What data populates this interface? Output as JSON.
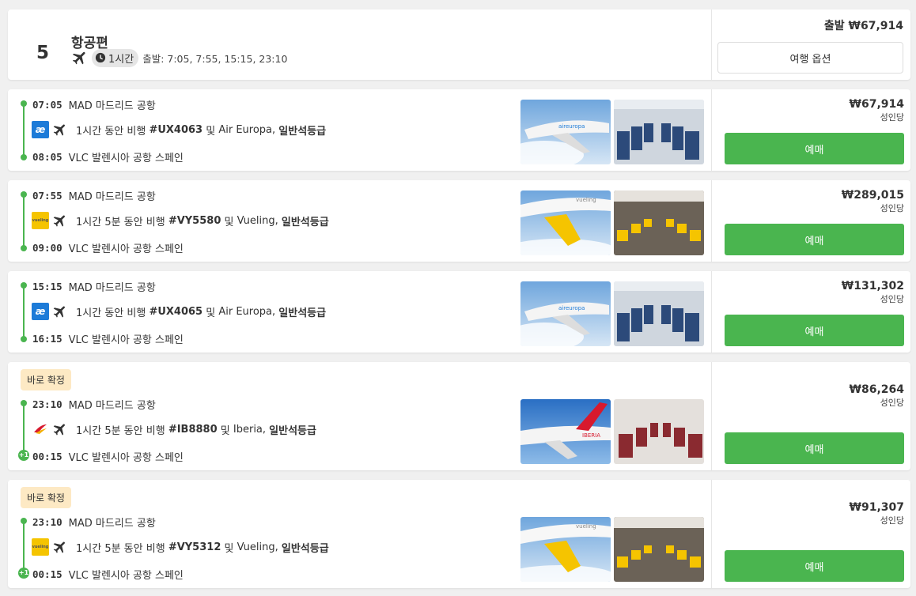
{
  "header": {
    "count": "5",
    "title": "항공편",
    "duration": "1시간",
    "departures": "출발: 7:05, 7:55, 15:15, 23:10",
    "from_price": "출발 ₩67,914",
    "options_label": "여행 옵션",
    "icons": [
      "plane-icon",
      "clock-icon"
    ]
  },
  "flights": [
    {
      "dep_time": "07:05",
      "dep_airport": "MAD 마드리드 공항",
      "arr_time": "08:05",
      "arr_airport": "VLC 발렌시아 공항 스페인",
      "duration_text": "1시간 동안 비행",
      "flight_no": "#UX4063",
      "and": "및",
      "airline": "Air Europa,",
      "cabin": "일반석등급",
      "airline_logo": "air-europa-logo",
      "price": "₩67,914",
      "per": "성인당",
      "book_label": "예매"
    },
    {
      "dep_time": "07:55",
      "dep_airport": "MAD 마드리드 공항",
      "arr_time": "09:00",
      "arr_airport": "VLC 발렌시아 공항 스페인",
      "duration_text": "1시간 5분 동안 비행",
      "flight_no": "#VY5580",
      "and": "및",
      "airline": "Vueling,",
      "cabin": "일반석등급",
      "airline_logo": "vueling-logo",
      "price": "₩289,015",
      "per": "성인당",
      "book_label": "예매"
    },
    {
      "dep_time": "15:15",
      "dep_airport": "MAD 마드리드 공항",
      "arr_time": "16:15",
      "arr_airport": "VLC 발렌시아 공항 스페인",
      "duration_text": "1시간 동안 비행",
      "flight_no": "#UX4065",
      "and": "및",
      "airline": "Air Europa,",
      "cabin": "일반석등급",
      "airline_logo": "air-europa-logo",
      "price": "₩131,302",
      "per": "성인당",
      "book_label": "예매"
    },
    {
      "badge": "바로 확정",
      "dep_time": "23:10",
      "dep_airport": "MAD 마드리드 공항",
      "arr_time": "00:15",
      "arr_airport": "VLC 발렌시아 공항 스페인",
      "next_day": "+1",
      "duration_text": "1시간 5분 동안 비행",
      "flight_no": "#IB8880",
      "and": "및",
      "airline": "Iberia,",
      "cabin": "일반석등급",
      "airline_logo": "iberia-logo",
      "price": "₩86,264",
      "per": "성인당",
      "book_label": "예매"
    },
    {
      "badge": "바로 확정",
      "dep_time": "23:10",
      "dep_airport": "MAD 마드리드 공항",
      "arr_time": "00:15",
      "arr_airport": "VLC 발렌시아 공항 스페인",
      "next_day": "+1",
      "duration_text": "1시간 5분 동안 비행",
      "flight_no": "#VY5312",
      "and": "및",
      "airline": "Vueling,",
      "cabin": "일반석등급",
      "airline_logo": "vueling-logo",
      "price": "₩91,307",
      "per": "성인당",
      "book_label": "예매"
    }
  ],
  "colors": {
    "accent_green": "#4ab54f",
    "badge_bg": "#fde9c4",
    "air_europa": "#1d7bd8",
    "vueling": "#f5c400",
    "iberia": "#d7192d"
  }
}
